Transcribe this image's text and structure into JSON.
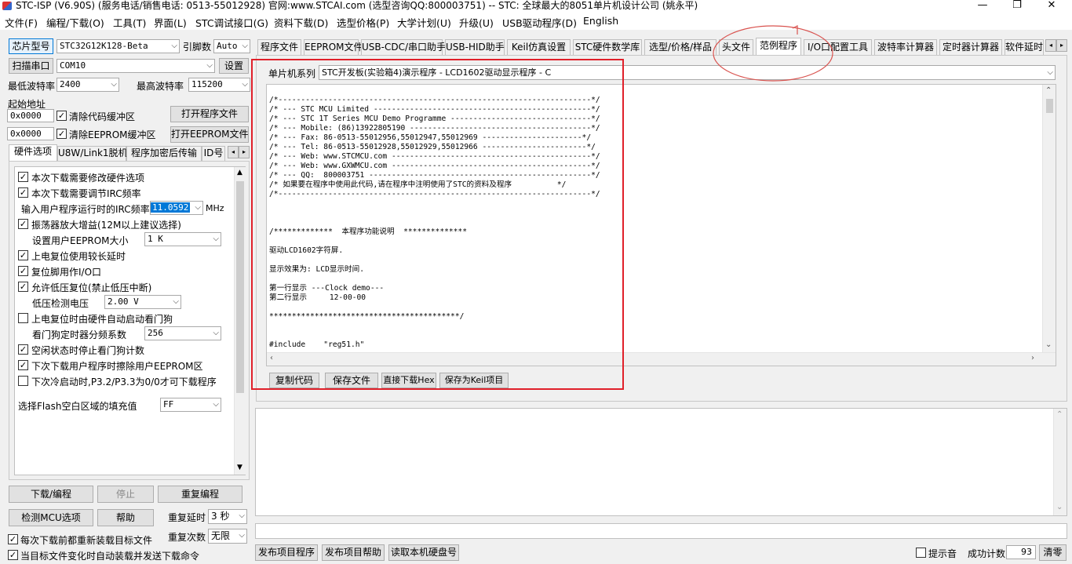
{
  "title": "STC-ISP (V6.90S) (服务电话/销售电话: 0513-55012928) 官网:www.STCAI.com  (选型咨询QQ:800003751) -- STC: 全球最大的8051单片机设计公司 (姚永平)",
  "window_controls": {
    "minimize": "—",
    "maximize": "❐",
    "close": "✕"
  },
  "menu": [
    "文件(F)",
    "编程/下载(O)",
    "工具(T)",
    "界面(L)",
    "STC调试接口(G)",
    "资料下载(D)",
    "选型价格(P)",
    "大学计划(U)",
    "升级(U)",
    "USB驱动程序(D)",
    "English"
  ],
  "left": {
    "chip_button": "芯片型号",
    "chip_value": "STC32G12K128-Beta",
    "pin_label": "引脚数",
    "pin_value": "Auto",
    "scan_button": "扫描串口",
    "com_value": "COM10",
    "settings_button": "设置",
    "min_baud_label": "最低波特率",
    "min_baud": "2400",
    "max_baud_label": "最高波特率",
    "max_baud": "115200",
    "start_addr_label": "起始地址",
    "addr1": "0x0000",
    "clear_code": "清除代码缓冲区",
    "open_prog": "打开程序文件",
    "addr2": "0x0000",
    "clear_eeprom": "清除EEPROM缓冲区",
    "open_eeprom": "打开EEPROM文件",
    "tabs": [
      "硬件选项",
      "U8W/Link1脱机",
      "程序加密后传输",
      "ID号"
    ],
    "options": [
      {
        "checked": true,
        "label": "本次下载需要修改硬件选项"
      },
      {
        "checked": true,
        "label": "本次下载需要调节IRC频率"
      },
      {
        "type": "input",
        "label": "输入用户程序运行时的IRC频率",
        "value": "11.0592",
        "unit": "MHz"
      },
      {
        "checked": true,
        "label": "振荡器放大增益(12M以上建议选择)"
      },
      {
        "type": "select",
        "label": "设置用户EEPROM大小",
        "value": "1   K"
      },
      {
        "checked": true,
        "label": "上电复位使用较长延时"
      },
      {
        "checked": true,
        "label": "复位脚用作I/O口"
      },
      {
        "checked": true,
        "label": "允许低压复位(禁止低压中断)"
      },
      {
        "type": "select",
        "label": "低压检测电压",
        "value": "2.00 V"
      },
      {
        "checked": false,
        "label": "上电复位时由硬件自动启动看门狗"
      },
      {
        "type": "select",
        "label": "看门狗定时器分频系数",
        "value": "256"
      },
      {
        "checked": true,
        "label": "空闲状态时停止看门狗计数"
      },
      {
        "checked": true,
        "label": "下次下载用户程序时擦除用户EEPROM区"
      },
      {
        "checked": false,
        "label": "下次冷启动时,P3.2/P3.3为0/0才可下载程序"
      },
      {
        "type": "select",
        "label": "选择Flash空白区域的填充值",
        "value": "FF"
      }
    ],
    "download_btn": "下载/编程",
    "stop_btn": "停止",
    "reprogram_btn": "重复编程",
    "detect_btn": "检测MCU选项",
    "help_btn": "帮助",
    "repeat_delay_label": "重复延时",
    "repeat_delay": "3 秒",
    "reload_chk": "每次下载前都重新装载目标文件",
    "repeat_count_label": "重复次数",
    "repeat_count": "无限",
    "autosend_chk": "当目标文件变化时自动装载并发送下载命令"
  },
  "right": {
    "tabs": [
      "程序文件",
      "EEPROM文件",
      "USB-CDC/串口助手",
      "USB-HID助手",
      "Keil仿真设置",
      "STC硬件数学库",
      "选型/价格/样品",
      "头文件",
      "范例程序",
      "I/O口配置工具",
      "波特率计算器",
      "定时器计算器",
      "软件延时"
    ],
    "series_label": "单片机系列",
    "series_value": "STC开发板(实验箱4)演示程序 - LCD1602驱动显示程序 - C",
    "code_lines": [
      "/*---------------------------------------------------------------------*/",
      "/* --- STC MCU Limited ------------------------------------------------*/",
      "/* --- STC 1T Series MCU Demo Programme -------------------------------*/",
      "/* --- Mobile: (86)13922805190 ----------------------------------------*/",
      "/* --- Fax: 86-0513-55012956,55012947,55012969 ----------------------*/",
      "/* --- Tel: 86-0513-55012928,55012929,55012966 -----------------------*/",
      "/* --- Web: www.STCMCU.com --------------------------------------------*/",
      "/* --- Web: www.GXWMCU.com --------------------------------------------*/",
      "/* --- QQ:  800003751 -------------------------------------------------*/",
      "/* 如果要在程序中使用此代码,请在程序中注明使用了STC的资料及程序          */",
      "/*---------------------------------------------------------------------*/",
      "",
      "",
      "",
      "/*************  本程序功能说明  **************",
      "",
      "驱动LCD1602字符屏.",
      "",
      "显示效果为: LCD显示时间.",
      "",
      "第一行显示 ---Clock demo---",
      "第二行显示     12-00-00",
      "",
      "******************************************/",
      "",
      "",
      "#include    \"reg51.h\""
    ],
    "copy_btn": "复制代码",
    "save_btn": "保存文件",
    "direct_btn": "直接下载Hex",
    "keil_btn": "保存为Keil项目",
    "publish_btn": "发布项目程序",
    "publish_help_btn": "发布项目帮助",
    "read_disk_btn": "读取本机硬盘号",
    "sound_chk": "提示音",
    "success_label": "成功计数",
    "success_count": "93",
    "clear_btn": "清零"
  },
  "colors": {
    "highlight_box": "#e0202a",
    "annotation_circle": "#d9534f",
    "selection": "#0078d7"
  }
}
